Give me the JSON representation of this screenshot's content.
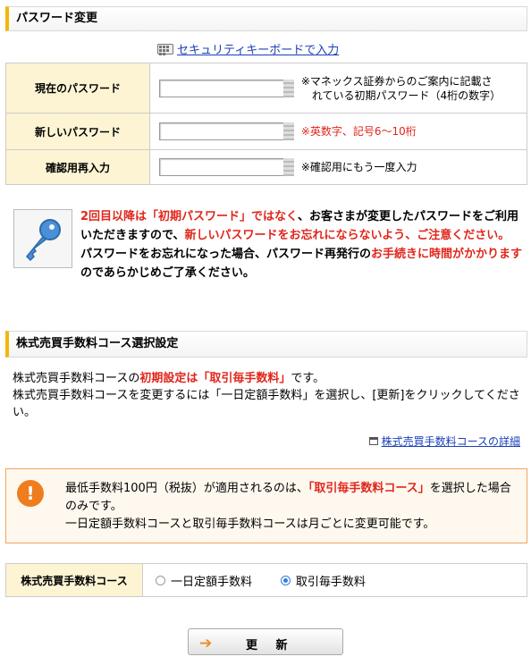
{
  "password_section": {
    "title": "パスワード変更",
    "security_keyboard_link": "セキュリティキーボードで入力",
    "rows": [
      {
        "label": "現在のパスワード",
        "note_line1": "※マネックス証券からのご案内に記載さ",
        "note_line2": "れている初期パスワード（4桁の数字）"
      },
      {
        "label": "新しいパスワード",
        "note": "※英数字、記号6〜10桁"
      },
      {
        "label": "確認用再入力",
        "note": "※確認用にもう一度入力"
      }
    ],
    "warning": {
      "seg1": "2回目以降は「初期パスワード」ではなく",
      "seg2": "、お客さまが変更したパスワードをご利用いただきますので、",
      "seg3": "新しいパスワードをお忘れにならないよう、ご注意ください。",
      "seg4": "パスワードをお忘れになった場合、パスワード再発行の",
      "seg5": "お手続きに時間がかかります",
      "seg6": "のであらかじめご了承ください。"
    }
  },
  "fee_section": {
    "title": "株式売買手数料コース選択設定",
    "para": {
      "p1a": "株式売買手数料コースの",
      "p1b": "初期設定は「取引毎手数料」",
      "p1c": "です。",
      "p2": "株式売買手数料コースを変更するには「一日定額手数料」を選択し、[更新]をクリックしてください。"
    },
    "detail_link": "株式売買手数料コースの詳細",
    "notice": {
      "n1a": "最低手数料100円（税抜）が適用されるのは、",
      "n1b": "「取引毎手数料コース」",
      "n1c": "を選択した場合のみです。",
      "n2": "一日定額手数料コースと取引毎手数料コースは月ごとに変更可能です。"
    },
    "course_label": "株式売買手数料コース",
    "options": [
      {
        "label": "一日定額手数料",
        "selected": false
      },
      {
        "label": "取引毎手数料",
        "selected": true
      }
    ]
  },
  "update_button": "更 新",
  "colors": {
    "accent_red": "#e0261b",
    "link_blue": "#1a3fb8",
    "label_bg": "#fdf4d4",
    "header_bar": "#f2b705",
    "notice_border": "#f0a35e"
  }
}
